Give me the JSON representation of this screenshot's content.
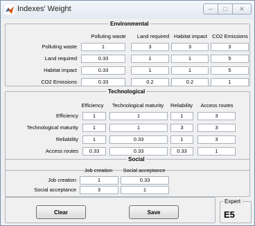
{
  "window": {
    "title": "Indexes' Weight"
  },
  "environmental": {
    "title": "Environmental",
    "columns": [
      "Polluting waste",
      "Land required",
      "Habitat impact",
      "CO2 Emissions"
    ],
    "rows": [
      {
        "label": "Polluting waste",
        "values": [
          "1",
          "3",
          "3",
          "3"
        ]
      },
      {
        "label": "Land required",
        "values": [
          "0.33",
          "1",
          "1",
          "5"
        ]
      },
      {
        "label": "Habitat impact",
        "values": [
          "0.33",
          "1",
          "1",
          "5"
        ]
      },
      {
        "label": "CO2 Emissions",
        "values": [
          "0.33",
          "0.2",
          "0.2",
          "1"
        ]
      }
    ]
  },
  "technological": {
    "title": "Technological",
    "columns": [
      "Efficiency",
      "Technological maturity",
      "Reliability",
      "Access routes"
    ],
    "rows": [
      {
        "label": "Efficiency",
        "values": [
          "1",
          "1",
          "1",
          "3"
        ]
      },
      {
        "label": "Technological maturity",
        "values": [
          "1",
          "1",
          "3",
          "3"
        ]
      },
      {
        "label": "Reliability",
        "values": [
          "1",
          "0.33",
          "1",
          "3"
        ]
      },
      {
        "label": "Access routes",
        "values": [
          "0.33",
          "0.33",
          "0.33",
          "1"
        ]
      }
    ]
  },
  "social": {
    "title": "Social",
    "columns": [
      "Job creation",
      "Social acceptance"
    ],
    "rows": [
      {
        "label": "Job creation",
        "values": [
          "1",
          "0.33"
        ]
      },
      {
        "label": "Social acceptance",
        "values": [
          "3",
          "1"
        ]
      }
    ]
  },
  "actions": {
    "clear_label": "Clear",
    "save_label": "Save"
  },
  "expert": {
    "title": "Expert",
    "value": "E5"
  }
}
